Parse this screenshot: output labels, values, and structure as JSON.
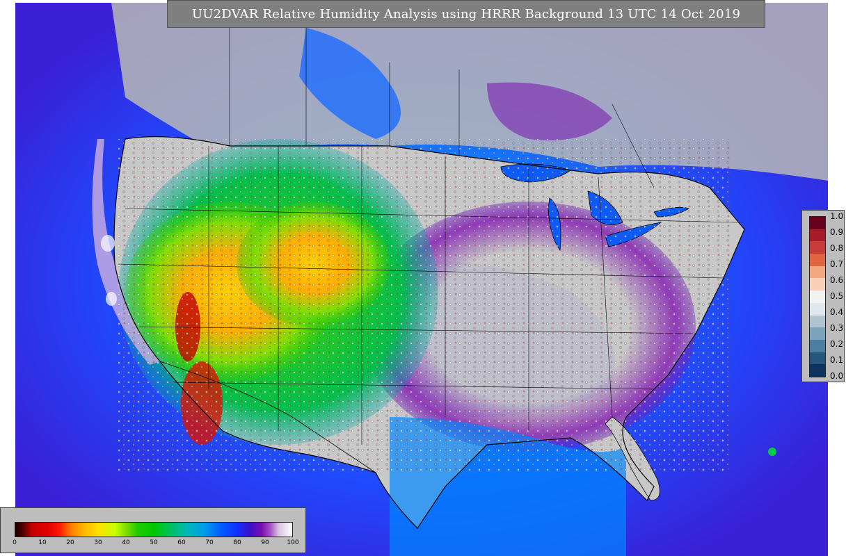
{
  "title": "UU2DVAR Relative Humidity Analysis using HRRR Background 13 UTC 14 Oct 2019",
  "right_colorbar": {
    "labels": [
      "1.0",
      "0.9",
      "0.8",
      "0.7",
      "0.6",
      "0.5",
      "0.4",
      "0.3",
      "0.2",
      "0.1",
      "0.0"
    ],
    "colors": [
      "#67001f",
      "#a51c2b",
      "#c93b3b",
      "#e0643f",
      "#f4a582",
      "#f8cfb9",
      "#f2f2f2",
      "#dfe6ec",
      "#b0c3d1",
      "#7aa3bc",
      "#4a7ea3",
      "#27567c",
      "#0d3360"
    ]
  },
  "bottom_colorbar": {
    "labels": [
      "0",
      "10",
      "20",
      "30",
      "40",
      "50",
      "60",
      "70",
      "80",
      "90",
      "100"
    ]
  },
  "palette": {
    "land_dry": "#ff9a00",
    "ocean": "#1a5cff",
    "moist": "#7a10b0",
    "no_data": "#c8c8c8"
  }
}
